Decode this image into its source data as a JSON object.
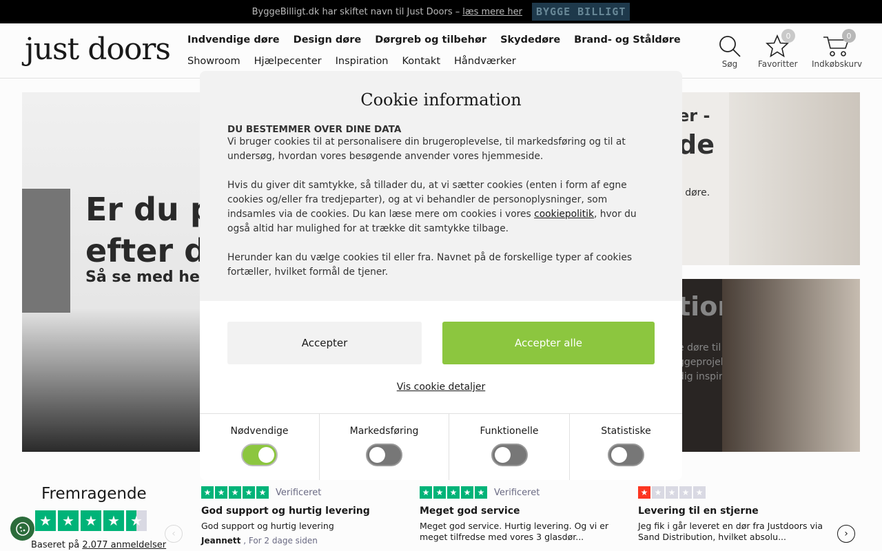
{
  "topbar": {
    "text": "ByggeBilligt.dk har skiftet navn til Just Doors –",
    "link": "læs mere her",
    "partner_logo": "BYGGE BILLIGT"
  },
  "header": {
    "logo": "just doors",
    "nav_primary": [
      "Indvendige døre",
      "Design døre",
      "Dørgreb og tilbehør",
      "Skydedøre",
      "Brand- og Ståldøre"
    ],
    "nav_secondary": [
      "Showroom",
      "Hjælpecenter",
      "Inspiration",
      "Kontakt",
      "Håndværker"
    ],
    "search_label": "Søg",
    "favorites_label": "Favoritter",
    "favorites_count": "0",
    "cart_label": "Indkøbskurv",
    "cart_count": "0"
  },
  "hero": {
    "heading_line1": "Er du p",
    "heading_line2": "efter de",
    "subheading": "Så se med her!"
  },
  "tiles": {
    "tile1_heading": "er -",
    "tile1_heading2": "de",
    "tile1_text": "r døre.",
    "tile2_heading": "tion",
    "tile2_text1": "e døre til",
    "tile2_text2": "ggeprojekter.",
    "tile2_text3": "dig inspirere."
  },
  "cookie_modal": {
    "title": "Cookie information",
    "subtitle": "DU BESTEMMER OVER DINE DATA",
    "para1": "Vi bruger cookies til at personalisere din brugeroplevelse, til markedsføring og til at undersøg, hvordan vores besøgende anvender vores hjemmeside.",
    "para2_before": "Hvis du giver dit samtykke, så tillader du, at vi sætter cookies (enten i form af egne cookies og/eller fra tredjeparter), og at vi behandler de personoplysninger, som indsamles via de cookies. Du kan læse mere om cookies i vores ",
    "para2_link": "cookiepolitik",
    "para2_after": ", hvor du også altid har mulighed for at trække dit samtykke tilbage.",
    "para3": "Herunder kan du vælge cookies til eller fra. Navnet på de forskellige typer af cookies fortæller, hvilket formål de tjener.",
    "accept_label": "Accepter",
    "accept_all_label": "Accepter alle",
    "details_link": "Vis cookie detaljer",
    "toggles": [
      {
        "label": "Nødvendige",
        "on": true
      },
      {
        "label": "Markedsføring",
        "on": false
      },
      {
        "label": "Funktionelle",
        "on": false
      },
      {
        "label": "Statistiske",
        "on": false
      }
    ],
    "accent_color": "#8cc63f"
  },
  "trustpilot": {
    "rating_word": "Fremragende",
    "based_on_prefix": "Baseret på",
    "reviews_count_link": "2.077 anmeldelser",
    "reviews": [
      {
        "stars": 5,
        "verified": "Verificeret",
        "title": "God support og hurtig levering",
        "body": "God support og hurtig levering",
        "author": "Jeannett",
        "time": "For 2 dage siden"
      },
      {
        "stars": 5,
        "verified": "Verificeret",
        "title": "Meget god service",
        "body": "Meget god service. Hurtig levering. Og vi er meget tilfredse med vores 3 glasdør...",
        "author": "",
        "time": ""
      },
      {
        "stars": 1,
        "verified": "",
        "title": "Levering til en stjerne",
        "body": "Jeg fik i går leveret en dør fra Justdoors via Sand Distribution, hvilket absolu...",
        "author": "",
        "time": ""
      }
    ]
  }
}
